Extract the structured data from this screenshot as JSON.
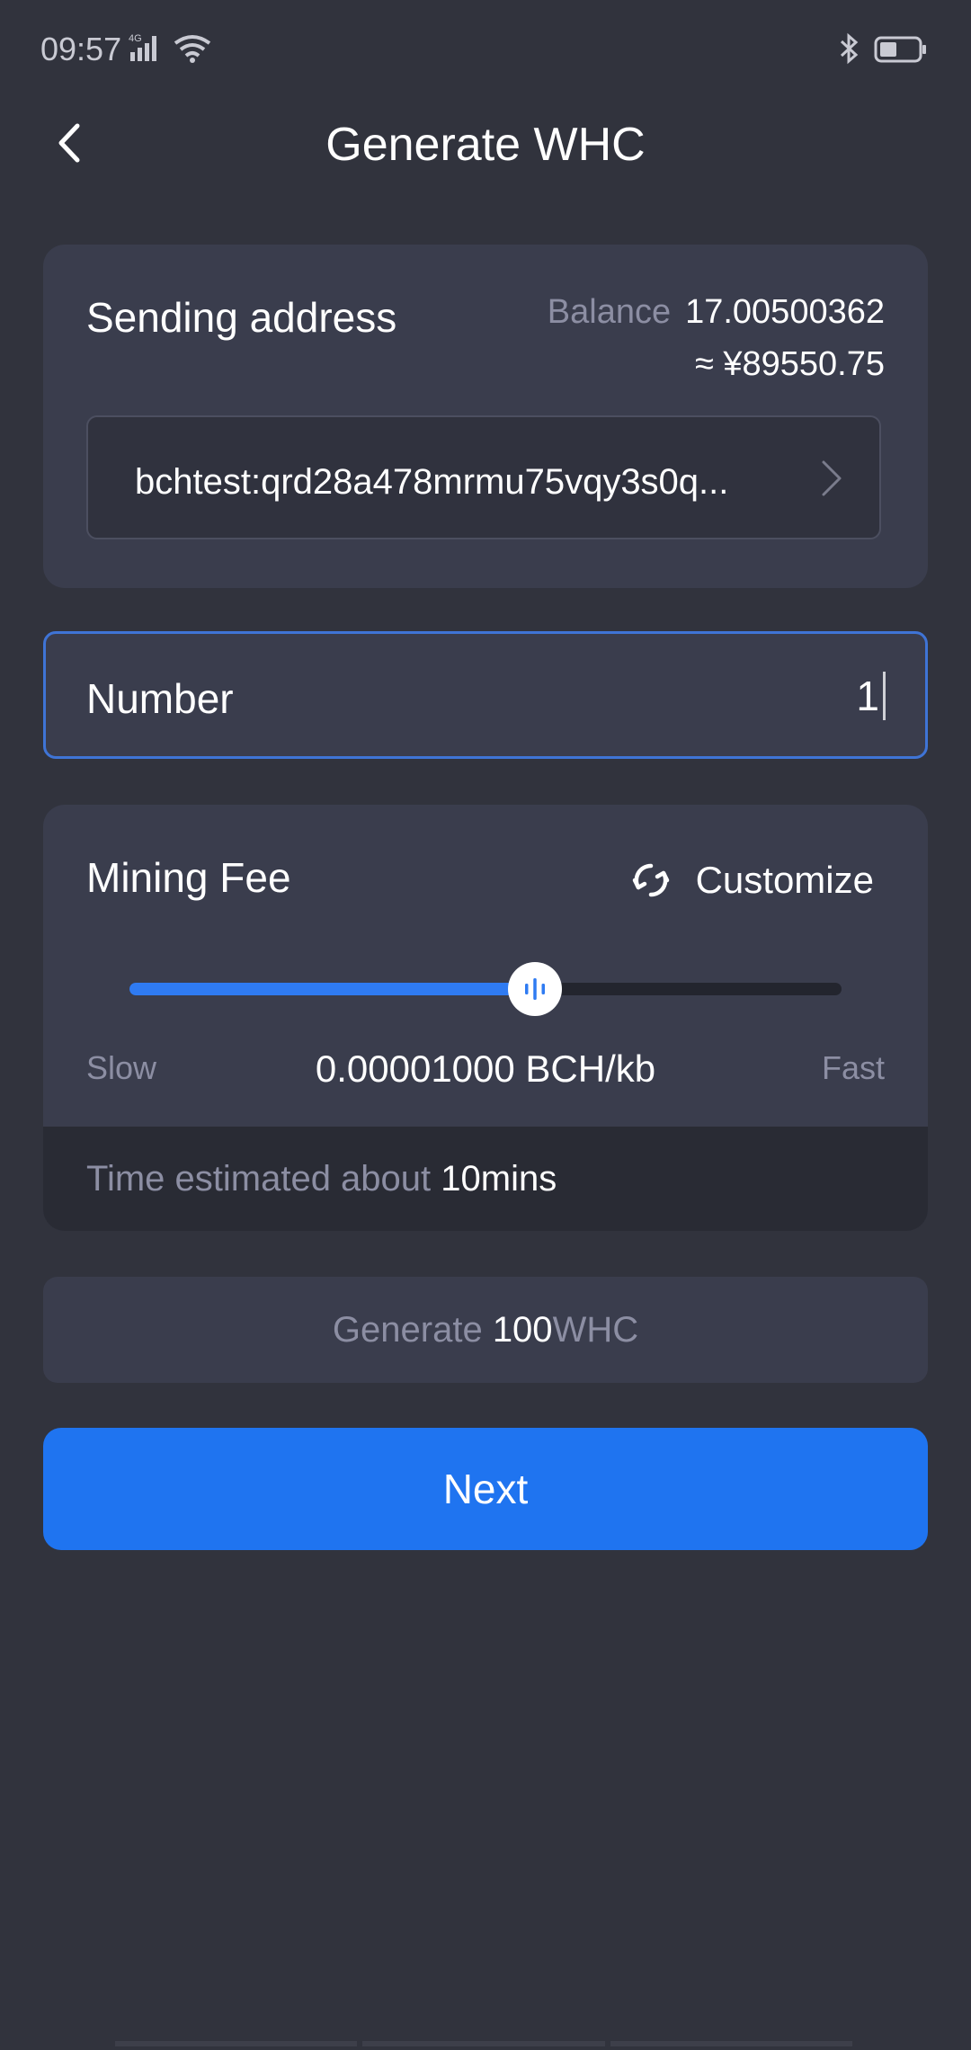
{
  "status_bar": {
    "time": "09:57",
    "network": "4G",
    "icons": [
      "signal-icon",
      "wifi-icon",
      "bluetooth-icon",
      "battery-icon"
    ]
  },
  "header": {
    "title": "Generate WHC",
    "back_icon": "chevron-left-icon"
  },
  "sending": {
    "label": "Sending address",
    "balance_label": "Balance",
    "balance_value": "17.00500362",
    "fiat_value": "≈ ¥89550.75",
    "address": "bchtest:qrd28a478mrmu75vqy3s0q...",
    "address_icon": "chevron-right-icon"
  },
  "number": {
    "label": "Number",
    "value": "1"
  },
  "fee": {
    "label": "Mining Fee",
    "customize_label": "Customize",
    "customize_icon": "refresh-icon",
    "slow_label": "Slow",
    "fast_label": "Fast",
    "value": "0.00001000 BCH/kb",
    "slider_level": 0.57,
    "time_label": "Time estimated about",
    "time_value": "10mins"
  },
  "generate": {
    "prefix": "Generate",
    "amount": "100",
    "unit": "WHC"
  },
  "actions": {
    "next_label": "Next"
  },
  "colors": {
    "background": "#31333d",
    "card": "#3a3d4d",
    "accent": "#1f74f0",
    "muted_text": "#8c8ea3"
  }
}
